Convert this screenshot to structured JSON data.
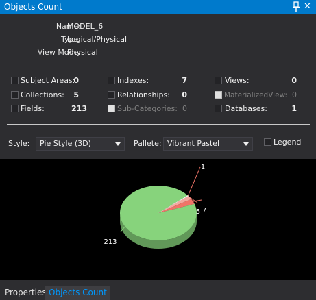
{
  "panel": {
    "title": "Objects Count"
  },
  "info": [
    {
      "label": "Name:",
      "value": "MODEL_6"
    },
    {
      "label": "Type:",
      "value": "Logical/Physical"
    },
    {
      "label": "View Mode:",
      "value": "Physical"
    }
  ],
  "counts": [
    {
      "label": "Subject Areas:",
      "value": "0",
      "enabled": true
    },
    {
      "label": "Indexes:",
      "value": "7",
      "enabled": true
    },
    {
      "label": "Views:",
      "value": "0",
      "enabled": true
    },
    {
      "label": "Collections:",
      "value": "5",
      "enabled": true
    },
    {
      "label": "Relationships:",
      "value": "0",
      "enabled": true
    },
    {
      "label": "MaterializedView:",
      "value": "0",
      "enabled": false
    },
    {
      "label": "Fields:",
      "value": "213",
      "enabled": true
    },
    {
      "label": "Sub-Categories:",
      "value": "0",
      "enabled": false
    },
    {
      "label": "Databases:",
      "value": "1",
      "enabled": true
    }
  ],
  "options": {
    "style_label": "Style:",
    "style_value": "Pie Style (3D)",
    "pallete_label": "Pallete:",
    "pallete_value": "Vibrant Pastel",
    "legend_label": "Legend",
    "legend_checked": false
  },
  "chart_data": {
    "type": "pie",
    "title": "",
    "style": "3D",
    "slices": [
      {
        "label": "213",
        "value": 213,
        "color": "#87d37c"
      },
      {
        "label": "7",
        "value": 7,
        "color": "#f07468"
      },
      {
        "label": "5",
        "value": 5,
        "color": "#f3a9a0"
      },
      {
        "label": "1",
        "value": 1,
        "color": "#ffffff"
      }
    ]
  },
  "tabs": [
    {
      "label": "Properties",
      "active": false
    },
    {
      "label": "Objects Count",
      "active": true
    }
  ],
  "colors": {
    "accent": "#007acc",
    "background": "#2d2d30",
    "chart_background": "#000000",
    "active_tab_text": "#0097fb"
  }
}
